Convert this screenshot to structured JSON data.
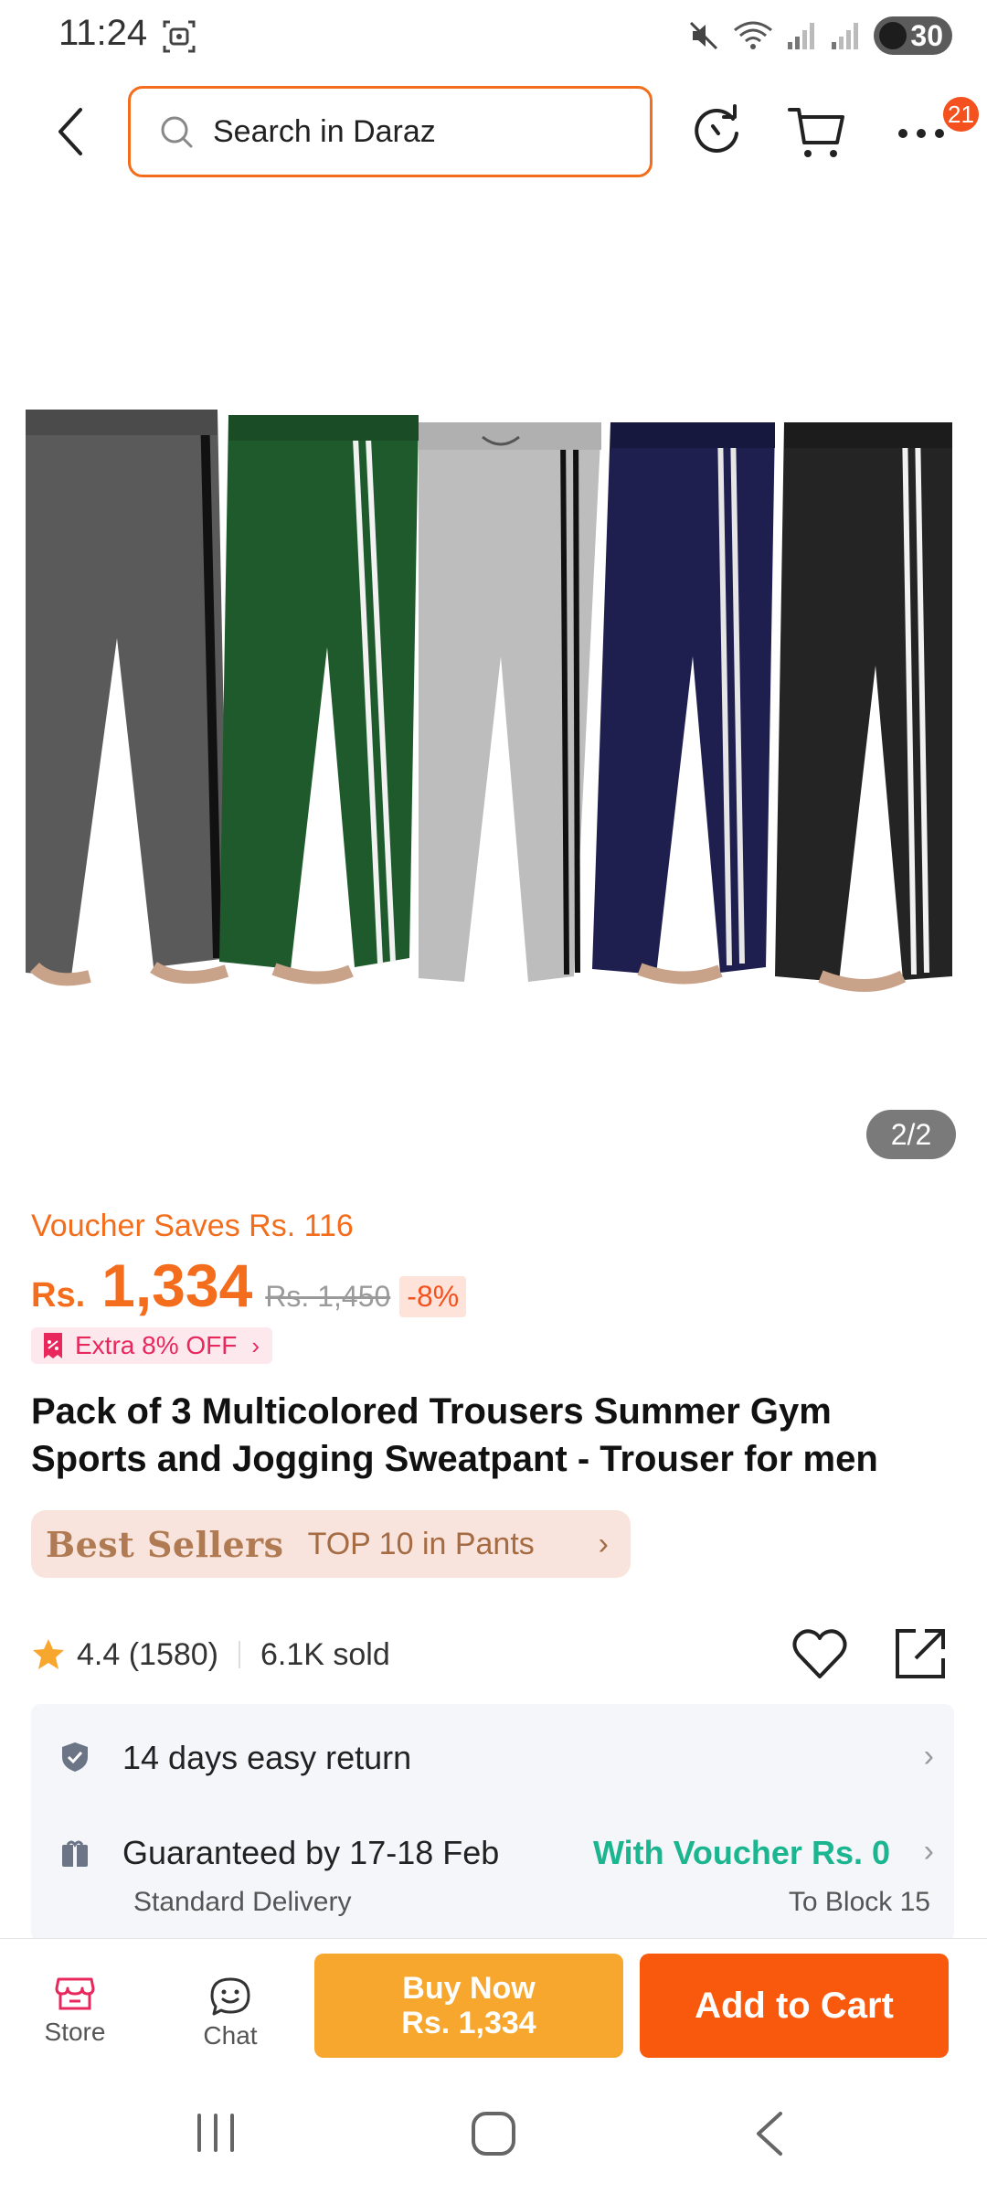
{
  "status_bar": {
    "time": "11:24",
    "battery": "30",
    "icons": [
      "screenshot-icon",
      "mute-icon",
      "wifi-icon",
      "signal-icon",
      "signal-icon",
      "battery-icon"
    ]
  },
  "header": {
    "search_placeholder": "Search in Daraz",
    "more_badge": "21",
    "icons": [
      "back-arrow-icon",
      "search-icon",
      "refresh-icon",
      "cart-icon",
      "more-icon"
    ]
  },
  "gallery": {
    "counter": "2/2",
    "trouser_colors": [
      "#5a5a5a",
      "#1f5a2c",
      "#b9b9b9",
      "#1e1f4f",
      "#222222"
    ]
  },
  "product": {
    "voucher_saves": "Voucher Saves Rs. 116",
    "price_currency": "Rs.",
    "price_amount": "1,334",
    "price_original": "Rs. 1,450",
    "discount": "-8%",
    "extra_off": "Extra 8% OFF",
    "title": "Pack of 3 Multicolored Trousers Summer Gym Sports and Jogging Sweatpant - Trouser for men",
    "bestseller_label": "Best Sellers",
    "bestseller_rank": "TOP 10 in Pants",
    "rating": "4.4 (1580)",
    "sold": "6.1K sold"
  },
  "delivery": {
    "return_text": "14 days easy return",
    "guarantee_text": "Guaranteed by 17-18 Feb",
    "voucher_text": "With Voucher Rs. 0",
    "delivery_type": "Standard Delivery",
    "destination": "To Block 15"
  },
  "actions": {
    "store_label": "Store",
    "chat_label": "Chat",
    "buy_now_label": "Buy Now",
    "buy_now_price": "Rs. 1,334",
    "add_to_cart_label": "Add to Cart"
  },
  "colors": {
    "brand_orange": "#f36d1c",
    "buy_now": "#f8a72e",
    "add_to_cart": "#f8590c",
    "voucher_green": "#1bb58f",
    "extra_pink": "#e8285c"
  }
}
